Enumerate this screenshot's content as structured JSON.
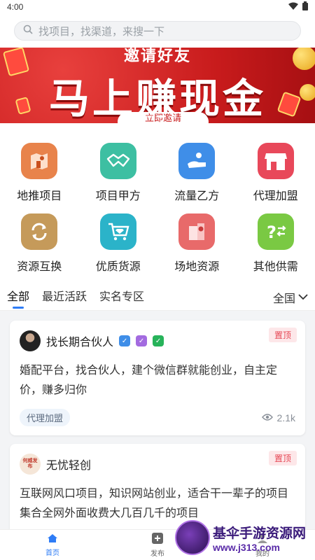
{
  "status": {
    "time": "4:00"
  },
  "search": {
    "placeholder": "找项目，找渠道，来搜一下"
  },
  "banner": {
    "subtitle": "邀请好友",
    "title": "马上赚现金",
    "cta": "立即邀请"
  },
  "categories": [
    {
      "label": "地推项目",
      "icon": "map-person-icon",
      "color": "#e8834b"
    },
    {
      "label": "项目甲方",
      "icon": "handshake-icon",
      "color": "#3dbfa2"
    },
    {
      "label": "流量乙方",
      "icon": "hand-tray-icon",
      "color": "#3f8ee8"
    },
    {
      "label": "代理加盟",
      "icon": "storefront-icon",
      "color": "#e8485a"
    },
    {
      "label": "资源互换",
      "icon": "swap-icon",
      "color": "#c59a5a"
    },
    {
      "label": "优质货源",
      "icon": "cart-diamond-icon",
      "color": "#2bb3c9"
    },
    {
      "label": "场地资源",
      "icon": "building-pin-icon",
      "color": "#e86a6a"
    },
    {
      "label": "其他供需",
      "icon": "question-exchange-icon",
      "color": "#7ac943"
    }
  ],
  "tabs": {
    "all": "全部",
    "recent": "最近活跃",
    "verified": "实名专区",
    "region": "全国"
  },
  "posts": [
    {
      "author": "找长期合伙人",
      "pinned": "置顶",
      "text": "婚配平台，找合伙人，建个微信群就能创业，自主定价，赚多归你",
      "tag": "代理加盟",
      "views": "2.1k"
    },
    {
      "author": "无忧轻创",
      "avatar_text": "何威发布",
      "pinned": "置顶",
      "text": "互联网风口项目，知识网站创业，适合干一辈子的项目集合全网外面收费大几百几千的项目"
    }
  ],
  "nav": {
    "home": "首页",
    "publish": "发布",
    "mine": "我的"
  },
  "watermark": {
    "line1": "基伞手游资源网",
    "line2": "www.j313.com"
  }
}
